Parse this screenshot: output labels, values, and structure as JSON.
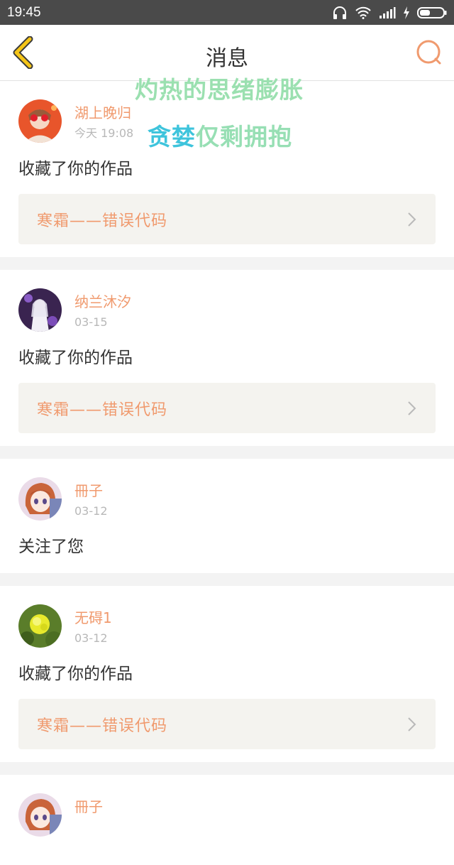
{
  "status_bar": {
    "time": "19:45"
  },
  "header": {
    "title": "消息"
  },
  "overlay": {
    "line1": "灼热的思绪膨胀",
    "line2_blue": "贪婪",
    "line2_rest": "仅剩拥抱"
  },
  "messages": [
    {
      "name": "湖上晚归",
      "time": "今天 19:08",
      "action": "收藏了你的作品",
      "work": "寒霜——错误代码"
    },
    {
      "name": "纳兰沐汐",
      "time": "03-15",
      "action": "收藏了你的作品",
      "work": "寒霜——错误代码"
    },
    {
      "name": "冊子",
      "time": "03-12",
      "action": "关注了您"
    },
    {
      "name": "无碍1",
      "time": "03-12",
      "action": "收藏了你的作品",
      "work": "寒霜——错误代码"
    },
    {
      "name": "冊子"
    }
  ],
  "colors": {
    "accent": "#f09a6e",
    "back_icon": "#f5c518"
  }
}
